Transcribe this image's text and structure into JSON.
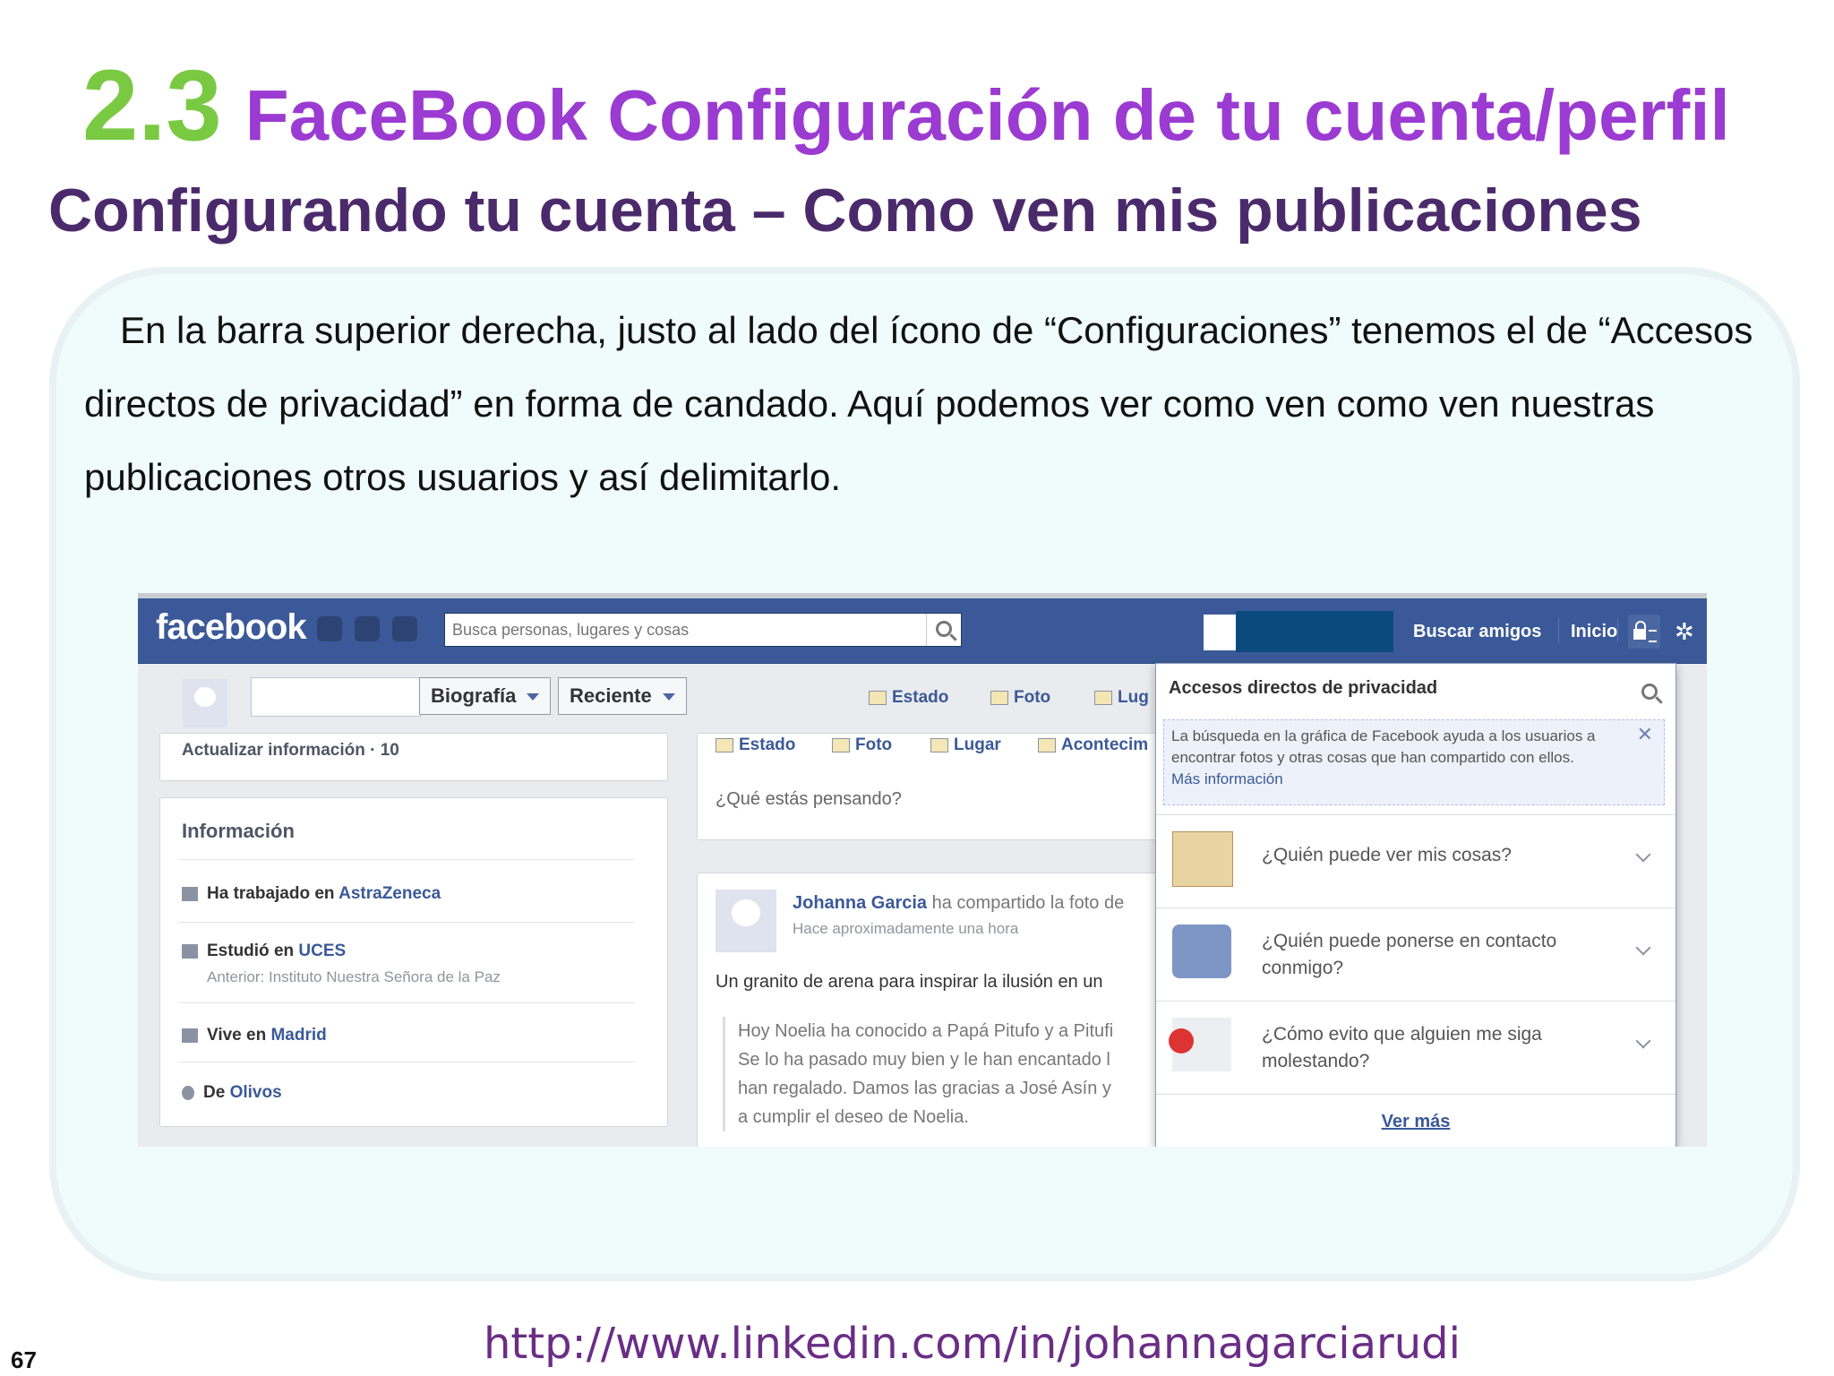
{
  "slide": {
    "number_prefix": "2.3",
    "title": "FaceBook Configuración de tu cuenta/perfil",
    "subtitle": "Configurando tu cuenta – Como ven mis publicaciones",
    "intro": "En la barra superior derecha, justo al lado del ícono de “Configuraciones” tenemos el de “Accesos directos de privacidad” en forma de candado. Aquí podemos ver como ven como ven nuestras publicaciones otros usuarios y así delimitarlo.",
    "footer_url": "http://www.linkedin.com/in/johannagarciarudi",
    "page_number": "67",
    "colors": {
      "number": "#7ac943",
      "title": "#9b3bd1",
      "subtitle": "#4b2a6b",
      "facebook_blue": "#3b5998"
    }
  },
  "fb": {
    "logo": "facebook",
    "search_placeholder": "Busca personas, lugares y cosas",
    "nav": {
      "find_friends": "Buscar amigos",
      "home": "Inicio"
    },
    "timeline": {
      "biografia": "Biografía",
      "reciente": "Reciente",
      "actions": [
        "Estado",
        "Foto",
        "Lug"
      ],
      "update_info": "Actualizar información · 10",
      "composer_tabs": [
        "Estado",
        "Foto",
        "Lugar",
        "Acontecim"
      ],
      "composer_placeholder": "¿Qué estás pensando?"
    },
    "info": {
      "title": "Información",
      "work_prefix": "Ha trabajado en ",
      "work_link": "AstraZeneca",
      "study_prefix": "Estudió en ",
      "study_link": "UCES",
      "study_prev": "Anterior: Instituto Nuestra Señora de la Paz",
      "lives_prefix": "Vive en ",
      "lives_link": "Madrid",
      "from_prefix": "De ",
      "from_link": "Olivos"
    },
    "post": {
      "author": "Johanna Garcia",
      "action": "ha compartido la foto de",
      "time": "Hace aproximadamente una hora",
      "text": "Un granito de arena para inspirar la ilusión en un",
      "quote": [
        "Hoy Noelia ha conocido a Papá Pitufo y a Pitufi",
        "Se lo ha pasado muy bien y le han encantado l",
        "han regalado. Damos las gracias a José Asín y",
        "a cumplir el deseo de Noelia."
      ]
    },
    "privacy": {
      "header": "Accesos directos de privacidad",
      "note": "La búsqueda en la gráfica de Facebook ayuda a los usuarios a encontrar fotos y otras cosas que han compartido con ellos.",
      "note_link": "Más información",
      "items": [
        "¿Quién puede ver mis cosas?",
        "¿Quién puede ponerse en contacto conmigo?",
        "¿Cómo evito que alguien me siga molestando?"
      ],
      "more": "Ver más"
    }
  }
}
